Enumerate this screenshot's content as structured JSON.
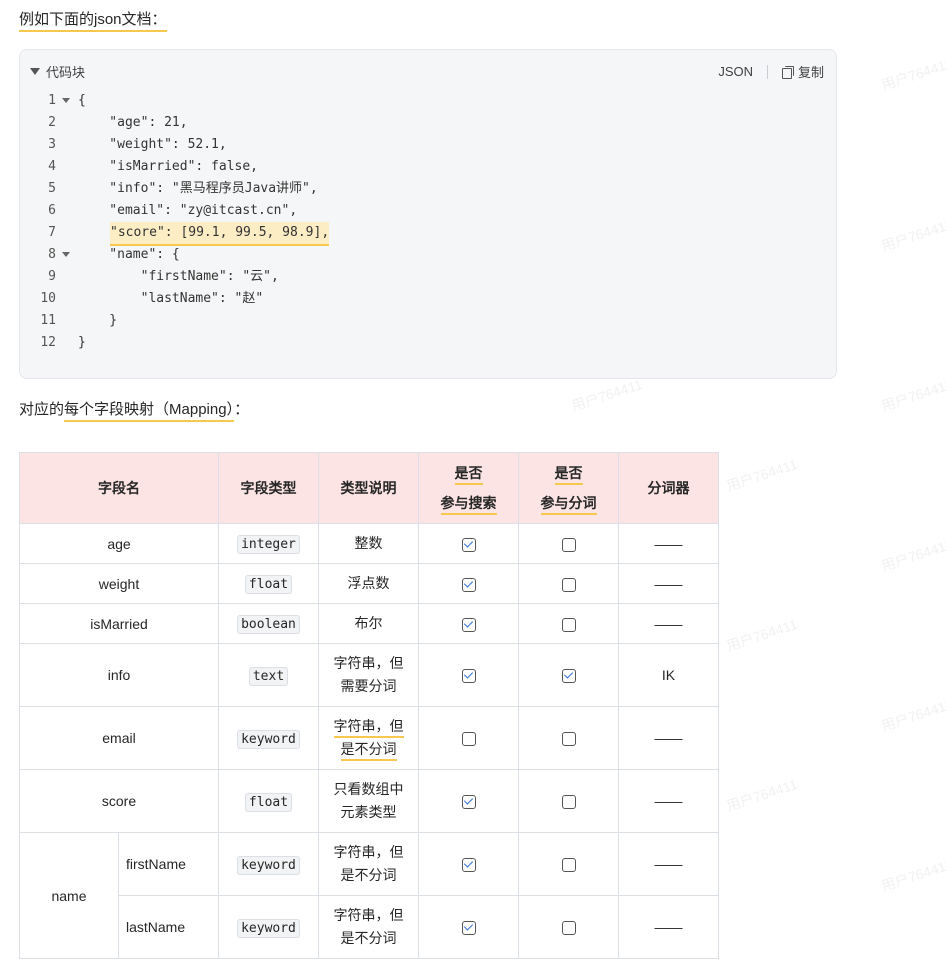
{
  "intro": "例如下面的json文档：",
  "codeblock": {
    "title": "代码块",
    "lang": "JSON",
    "copy": "复制",
    "lines": [
      {
        "n": "1",
        "t": "{",
        "fold": true
      },
      {
        "n": "2",
        "t": "    \"age\": 21,",
        "fold": false
      },
      {
        "n": "3",
        "t": "    \"weight\": 52.1,",
        "fold": false
      },
      {
        "n": "4",
        "t": "    \"isMarried\": false,",
        "fold": false
      },
      {
        "n": "5",
        "t": "    \"info\": \"黑马程序员Java讲师\",",
        "fold": false
      },
      {
        "n": "6",
        "t": "    \"email\": \"zy@itcast.cn\",",
        "fold": false
      },
      {
        "n": "7",
        "t": "\"score\": [99.1, 99.5, 98.9],",
        "fold": false,
        "highlight": true
      },
      {
        "n": "8",
        "t": "    \"name\": {",
        "fold": true
      },
      {
        "n": "9",
        "t": "        \"firstName\": \"云\",",
        "fold": false
      },
      {
        "n": "10",
        "t": "        \"lastName\": \"赵\"",
        "fold": false
      },
      {
        "n": "11",
        "t": "    }",
        "fold": false
      },
      {
        "n": "12",
        "t": "}",
        "fold": false
      }
    ]
  },
  "intro2_prefix": "对应的",
  "intro2_underlined": "每个字段映射（Mapping）",
  "intro2_suffix": "：",
  "table": {
    "headers": {
      "field": "字段名",
      "type": "字段类型",
      "desc": "类型说明",
      "search_a": "是否",
      "search_b": "参与搜索",
      "analyze_a": "是否",
      "analyze_b": "参与分词",
      "analyzer": "分词器"
    },
    "rows": [
      {
        "field": "age",
        "type": "integer",
        "desc1": "整数",
        "desc2": "",
        "search": true,
        "analyze": false,
        "analyzer": "——"
      },
      {
        "field": "weight",
        "type": "float",
        "desc1": "浮点数",
        "desc2": "",
        "search": true,
        "analyze": false,
        "analyzer": "——"
      },
      {
        "field": "isMarried",
        "type": "boolean",
        "desc1": "布尔",
        "desc2": "",
        "search": true,
        "analyze": false,
        "analyzer": "——"
      },
      {
        "field": "info",
        "type": "text",
        "desc1": "字符串，但",
        "desc2": "需要分词",
        "search": true,
        "analyze": true,
        "analyzer": "IK"
      },
      {
        "field": "email",
        "type": "keyword",
        "desc1": "字符串，但",
        "desc2": "是不分词",
        "search": false,
        "analyze": false,
        "analyzer": "——"
      },
      {
        "field": "score",
        "type": "float",
        "desc1": "只看数组中",
        "desc2": "元素类型",
        "search": true,
        "analyze": false,
        "analyzer": "——"
      }
    ],
    "name_group": {
      "parent": "name",
      "children": [
        {
          "field": "firstName",
          "type": "keyword",
          "desc1": "字符串，但",
          "desc2": "是不分词",
          "search": true,
          "analyze": false,
          "analyzer": "——"
        },
        {
          "field": "lastName",
          "type": "keyword",
          "desc1": "字符串，但",
          "desc2": "是不分词",
          "search": true,
          "analyze": false,
          "analyzer": "——"
        }
      ]
    }
  },
  "watermark": "用户764411",
  "colors": {
    "highlight": "#fdedc5",
    "underline": "#f6c94e",
    "header_bg": "#fce4e4",
    "check": "#2f6fd6"
  }
}
